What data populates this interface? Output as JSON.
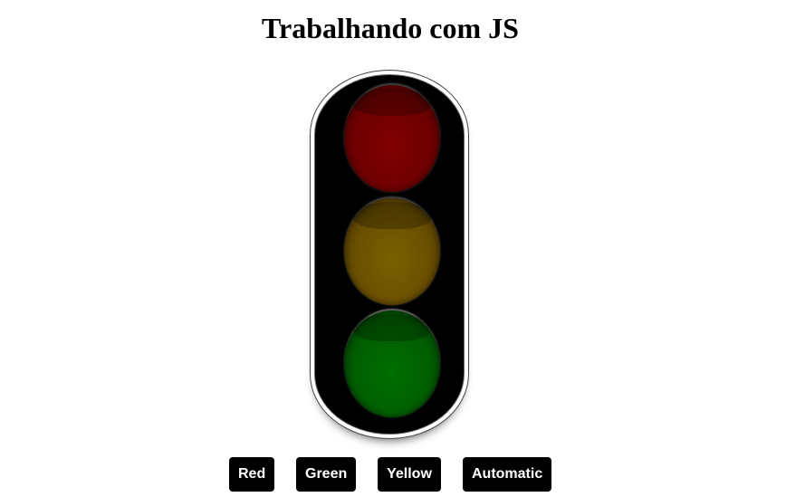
{
  "page": {
    "title": "Trabalhando com JS"
  },
  "traffic_light": {
    "lamps": [
      {
        "name": "red",
        "color": "#6f0000",
        "state": "off"
      },
      {
        "name": "yellow",
        "color": "#6a4f00",
        "state": "off"
      },
      {
        "name": "green",
        "color": "#005e00",
        "state": "off"
      }
    ]
  },
  "buttons": {
    "red": "Red",
    "green": "Green",
    "yellow": "Yellow",
    "automatic": "Automatic"
  },
  "colors": {
    "button_background": "#000000",
    "button_text": "#ffffff",
    "housing": "#000000"
  }
}
